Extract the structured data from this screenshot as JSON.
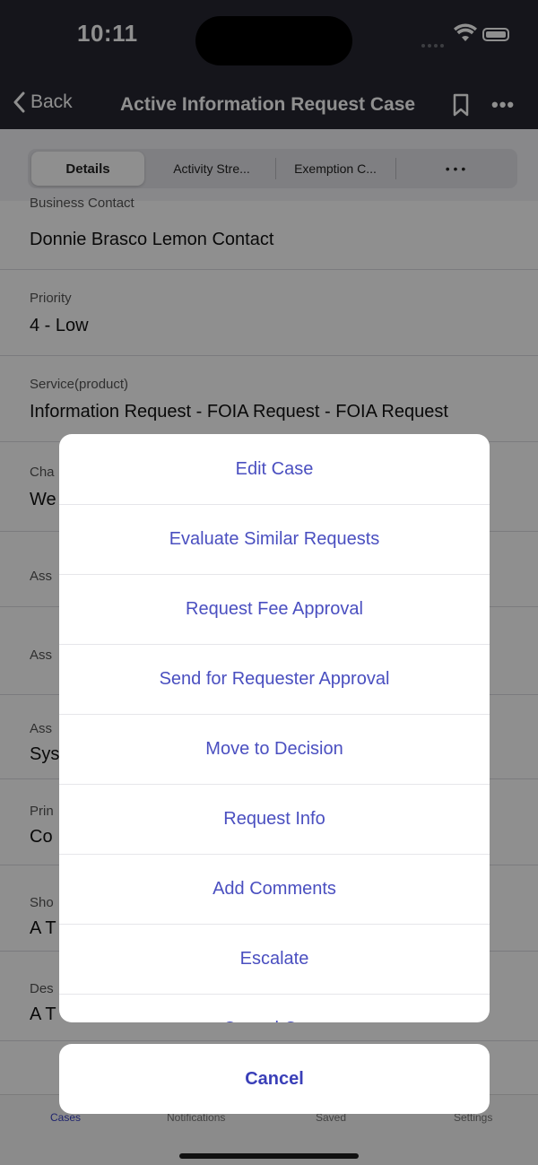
{
  "status": {
    "time": "10:11"
  },
  "nav": {
    "back_label": "Back",
    "title": "Active Information Request Case"
  },
  "tabs": [
    "Details",
    "Activity Stre...",
    "Exemption C...",
    "• • •"
  ],
  "fields": [
    {
      "label": "Business Contact",
      "value": "Donnie Brasco Lemon Contact"
    },
    {
      "label": "Priority",
      "value": "4 - Low"
    },
    {
      "label": "Service(product)",
      "value": "Information Request - FOIA Request - FOIA Request"
    },
    {
      "label": "Cha",
      "value": "We"
    },
    {
      "label": "Ass",
      "value": ""
    },
    {
      "label": "Ass",
      "value": ""
    },
    {
      "label": "Ass",
      "value": "Sys"
    },
    {
      "label": "Prin",
      "value": "Co"
    },
    {
      "label": "Sho",
      "value": "A T"
    },
    {
      "label": "Des",
      "value": "A T"
    }
  ],
  "actions": [
    "Edit Case",
    "Evaluate Similar Requests",
    "Request Fee Approval",
    "Send for Requester Approval",
    "Move to Decision",
    "Request Info",
    "Add Comments",
    "Escalate",
    "Cancel Case"
  ],
  "cancel_label": "Cancel",
  "tabbar": [
    "Cases",
    "Notifications",
    "Saved",
    "Settings"
  ],
  "colors": {
    "nav_bg": "#262731",
    "accent": "#3a42c4",
    "action_text": "#4a4fc0"
  }
}
